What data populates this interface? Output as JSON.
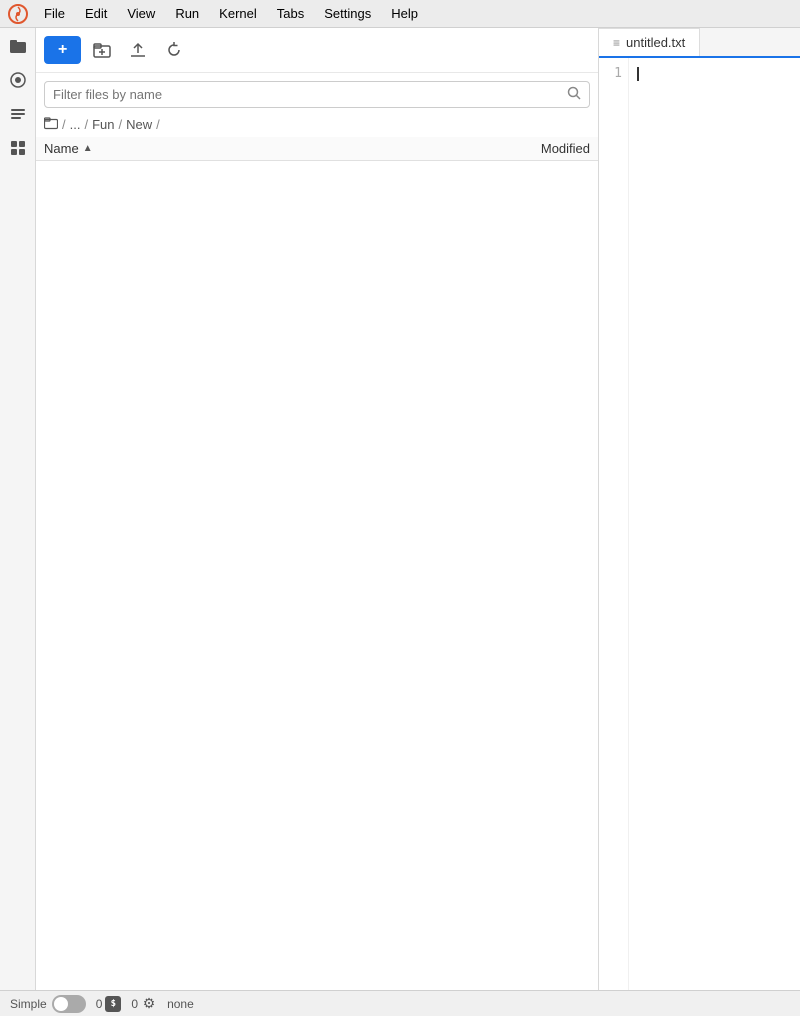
{
  "menubar": {
    "items": [
      "File",
      "Edit",
      "View",
      "Run",
      "Kernel",
      "Tabs",
      "Settings",
      "Help"
    ]
  },
  "sidebar": {
    "icons": [
      {
        "name": "folder-icon",
        "symbol": "📁"
      },
      {
        "name": "circle-icon",
        "symbol": "⬤"
      },
      {
        "name": "list-icon",
        "symbol": "☰"
      },
      {
        "name": "puzzle-icon",
        "symbol": "🧩"
      }
    ]
  },
  "toolbar": {
    "new_button_label": "+",
    "new_folder_label": "+",
    "upload_label": "↑",
    "refresh_label": "↺"
  },
  "search": {
    "placeholder": "Filter files by name"
  },
  "breadcrumb": {
    "parts": [
      "/",
      "...",
      "Fun",
      "New",
      ""
    ]
  },
  "file_table": {
    "columns": {
      "name": "Name",
      "modified": "Modified"
    },
    "rows": []
  },
  "editor": {
    "tab_label": "untitled.txt",
    "tab_icon": "≡",
    "line_numbers": [
      "1"
    ],
    "content": ""
  },
  "status_bar": {
    "mode_label": "Simple",
    "toggle_state": false,
    "count1": "0",
    "count2": "0",
    "mode_text": "none"
  }
}
